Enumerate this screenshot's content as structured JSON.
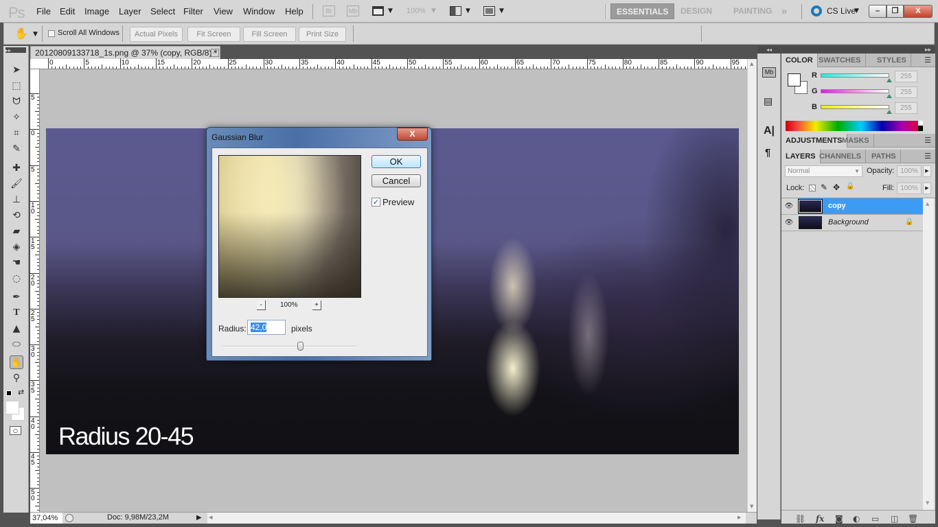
{
  "app": {
    "logo": "Ps"
  },
  "menu": [
    "File",
    "Edit",
    "Image",
    "Layer",
    "Select",
    "Filter",
    "View",
    "Window",
    "Help"
  ],
  "appbar": {
    "bridge_label": "Br",
    "minibridge_label": "Mb",
    "zoom_value": "100%",
    "workspaces": [
      "ESSENTIALS",
      "DESIGN",
      "PAINTING"
    ],
    "active_workspace": "ESSENTIALS",
    "more_label": "»",
    "cs_live_label": "CS Live"
  },
  "window_controls": {
    "minimize": "–",
    "restore": "❐",
    "close": "X"
  },
  "options_bar": {
    "scroll_all_windows_label": "Scroll All Windows",
    "scroll_all_windows_checked": false,
    "buttons": [
      "Actual Pixels",
      "Fit Screen",
      "Fill Screen",
      "Print Size"
    ]
  },
  "document": {
    "tab_title": "20120809133718_1s.png @ 37% (copy, RGB/8) *",
    "close_label": "×",
    "caption": "Radius 20-45"
  },
  "rulers": {
    "horizontal": [
      "0",
      "5",
      "10",
      "15",
      "20",
      "25",
      "30",
      "35",
      "40",
      "45",
      "50",
      "55",
      "60",
      "65",
      "70",
      "75",
      "80",
      "85",
      "90",
      "95"
    ],
    "vertical": [
      "5",
      "0",
      "5",
      "10",
      "15",
      "20",
      "25",
      "30",
      "35",
      "40",
      "45",
      "50"
    ]
  },
  "dialog": {
    "title": "Gaussian Blur",
    "close_label": "X",
    "ok_label": "OK",
    "cancel_label": "Cancel",
    "preview_label": "Preview",
    "preview_checked": true,
    "zoom_out_label": "-",
    "zoom_in_label": "+",
    "preview_zoom": "100%",
    "radius_label": "Radius:",
    "radius_value": "42,0",
    "radius_unit": "pixels",
    "slider_fraction": 0.58
  },
  "status": {
    "zoom": "37,04%",
    "doc_info": "Doc: 9,98M/23,2M"
  },
  "color_panel": {
    "tabs": [
      "COLOR",
      "SWATCHES",
      "STYLES"
    ],
    "active_tab": "COLOR",
    "channels": [
      {
        "label": "R",
        "value": "255"
      },
      {
        "label": "G",
        "value": "255"
      },
      {
        "label": "B",
        "value": "255"
      }
    ],
    "foreground": "#ffffff",
    "background": "#ffffff"
  },
  "adjustments_panel": {
    "tabs": [
      "ADJUSTMENTS",
      "MASKS"
    ],
    "active_tab": "ADJUSTMENTS"
  },
  "layers_panel": {
    "tabs": [
      "LAYERS",
      "CHANNELS",
      "PATHS"
    ],
    "active_tab": "LAYERS",
    "blend_mode": "Normal",
    "opacity_label": "Opacity:",
    "opacity": "100%",
    "lock_label": "Lock:",
    "fill_label": "Fill:",
    "fill": "100%",
    "layers": [
      {
        "name": "copy",
        "visible": true,
        "selected": true,
        "locked": false
      },
      {
        "name": "Background",
        "visible": true,
        "selected": false,
        "locked": true
      }
    ]
  },
  "colors": {
    "selection": "#3d9bf4",
    "accent": "#3a8ee6"
  }
}
